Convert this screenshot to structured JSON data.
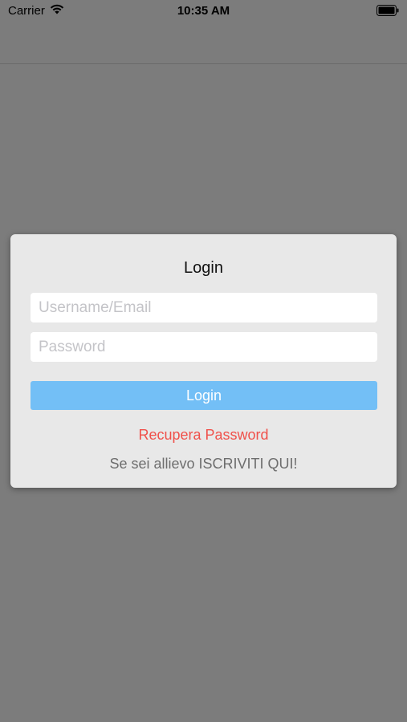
{
  "status_bar": {
    "carrier": "Carrier",
    "time": "10:35 AM",
    "wifi_icon": "wifi-icon",
    "battery_icon": "battery-icon"
  },
  "dialog": {
    "title": "Login",
    "username_placeholder": "Username/Email",
    "password_placeholder": "Password",
    "login_label": "Login",
    "recover_label": "Recupera Password",
    "register_label": "Se sei allievo ISCRIVITI QUI!"
  },
  "colors": {
    "overlay": "#7c7c7c",
    "dialog_bg": "#e8e8e8",
    "button_bg": "#73bff6",
    "recover_text": "#f0504a",
    "register_text": "#6e6e6e"
  }
}
